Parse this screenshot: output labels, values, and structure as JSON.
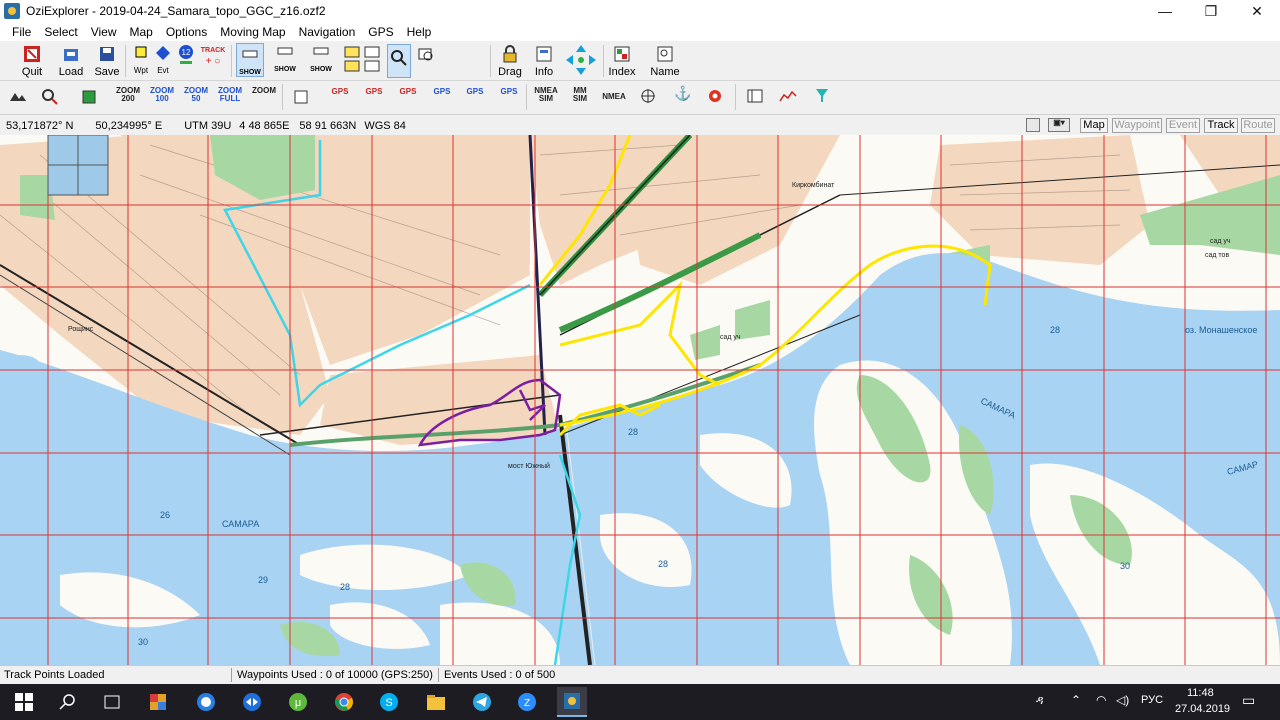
{
  "window": {
    "title": "OziExplorer - 2019-04-24_Samara_topo_GGC_z16.ozf2",
    "minimize": "—",
    "maximize": "❐",
    "close": "✕"
  },
  "menu": [
    "File",
    "Select",
    "View",
    "Map",
    "Options",
    "Moving Map",
    "Navigation",
    "GPS",
    "Help"
  ],
  "toolbar1": {
    "quit": "Quit",
    "load": "Load",
    "save": "Save",
    "wpt": "Wpt",
    "evt": "Evt",
    "track": "TRACK",
    "show": "SHOW",
    "zoom_value": "50",
    "drag": "Drag",
    "info": "Info",
    "index": "Index",
    "name": "Name"
  },
  "toolbar2": {
    "zoom200": "ZOOM\n200",
    "zoom100": "ZOOM\n100",
    "zoom50": "ZOOM\n50",
    "zoomfull": "ZOOM\nFULL",
    "zoomsel": "ZOOM",
    "gps": "GPS",
    "nmea_sim": "NMEA\nSIM",
    "mm_sim": "MM\nSIM",
    "nmea": "NMEA"
  },
  "coords": {
    "lat": "53,171872° N",
    "lon": "50,234995° E",
    "utm": "UTM  39U",
    "easting": "4 48 865E",
    "northing": "58 91 663N",
    "datum": "WGS 84"
  },
  "modes": {
    "map": "Map",
    "waypoint": "Waypoint",
    "event": "Event",
    "track": "Track",
    "route": "Route"
  },
  "map_labels": {
    "samara_river_1": "САМАРА",
    "samara_river_2": "САМАРА",
    "samara_river_3": "САМАР",
    "village": "Рощинс",
    "kombinat": "Киркомбинат",
    "bridge": "мост Южный",
    "lake": "оз. Монашенское",
    "num_26": "26",
    "num_28a": "28",
    "num_28b": "28",
    "num_28c": "28",
    "num_28d": "28",
    "num_29": "29",
    "num_30a": "30",
    "num_30b": "30",
    "sad": "сад уч",
    "sad2": "сад уч",
    "sad3": "сад тов"
  },
  "status": {
    "message": "Track Points Loaded",
    "waypoints": "Waypoints Used : 0 of 10000  (GPS:250)",
    "events": "Events Used : 0 of 500"
  },
  "taskbar": {
    "lang": "РУС",
    "time": "11:48",
    "date": "27.04.2019"
  },
  "colors": {
    "water": "#a9d3f2",
    "urban": "#f3d7bf",
    "forest": "#a7d8a4",
    "grid": "#d33",
    "track_yellow": "#ffe600",
    "track_cyan": "#3dd6e8",
    "track_purple": "#7a1fa0"
  }
}
